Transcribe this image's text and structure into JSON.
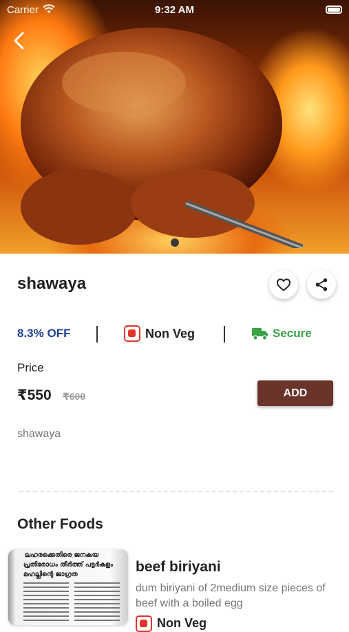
{
  "status_bar": {
    "carrier": "Carrier",
    "time": "9:32 AM"
  },
  "product": {
    "name": "shawaya",
    "discount": "8.3% OFF",
    "diet_type": "Non Veg",
    "diet_color": "#e2342a",
    "secure_label": "Secure",
    "secure_color": "#3aa346",
    "price_label": "Price",
    "price": "₹550",
    "original_price": "₹600",
    "add_label": "ADD",
    "description": "shawaya",
    "carousel_pages": 1,
    "carousel_active": 1
  },
  "other_foods": {
    "title": "Other Foods",
    "items": [
      {
        "name": "beef biriyani",
        "description": "dum biriyani of 2medium size pieces of beef with a boiled egg",
        "diet_type": "Non Veg",
        "thumb_lines": [
          "ലഹരക്കെതിരെ ജനകയ",
          "പ്രതിരോധം തീർത്ത് പട്ടർകുളം",
          "മഹല്ലിന്റെ ജാഗ്രത"
        ]
      }
    ]
  },
  "colors": {
    "accent_button": "#6b342a",
    "discount_text": "#1c3f97"
  }
}
